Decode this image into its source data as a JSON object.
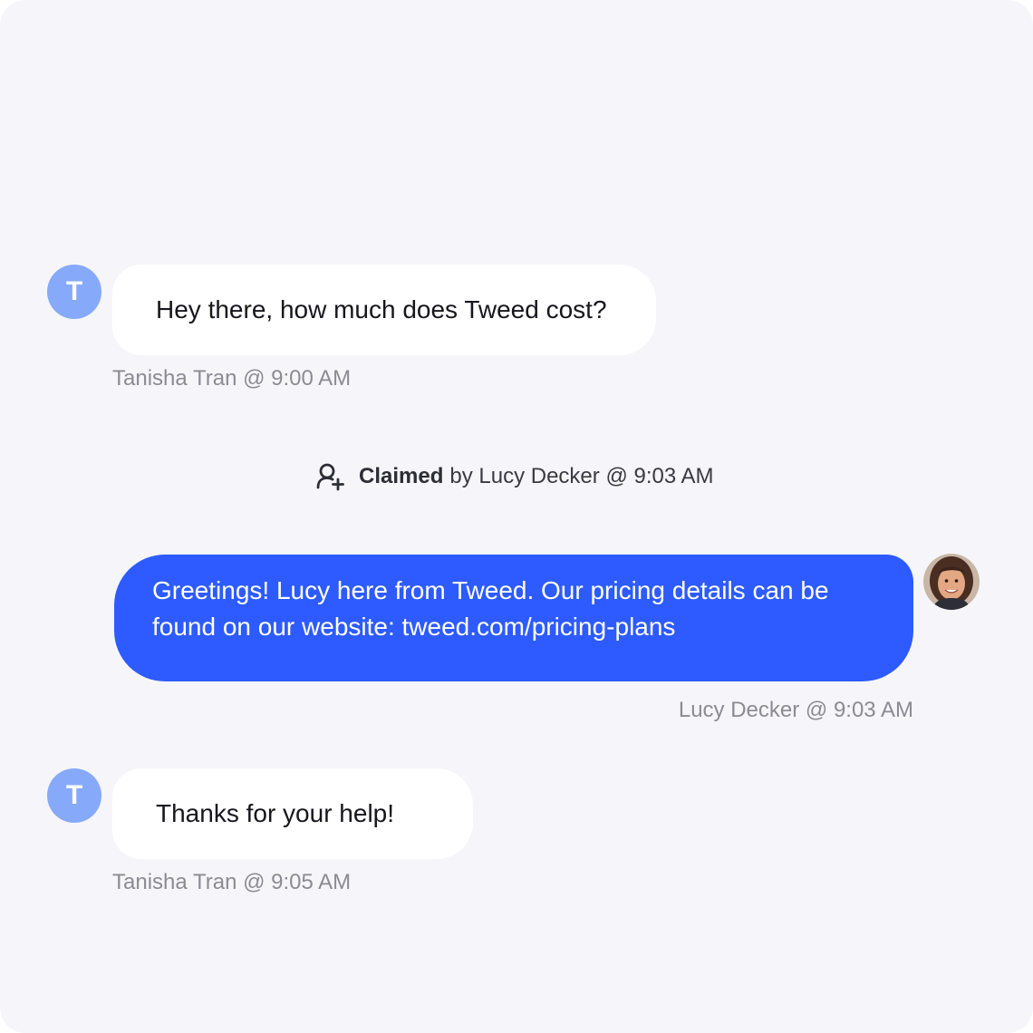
{
  "messages": [
    {
      "avatar_initial": "T",
      "text": "Hey there, how much does Tweed cost?",
      "meta": "Tanisha Tran @ 9:00 AM"
    },
    {
      "avatar_initial": "T",
      "text": "Thanks for your help!",
      "meta": "Tanisha Tran @ 9:05 AM"
    }
  ],
  "claim_event": {
    "icon": "user-plus-icon",
    "label": "Claimed",
    "detail": "by Lucy Decker @ 9:03 AM"
  },
  "agent_message": {
    "line1": "Greetings! Lucy here from Tweed. Our pricing details can be",
    "line2": "found on our website: tweed.com/pricing-plans",
    "meta": "Lucy Decker @ 9:03 AM",
    "avatar": "agent-photo"
  },
  "colors": {
    "background": "#f6f5fa",
    "customer_avatar": "#86aaf9",
    "agent_bubble": "#2d5bff",
    "customer_bubble": "#ffffff",
    "meta_text": "#8c8b93"
  }
}
